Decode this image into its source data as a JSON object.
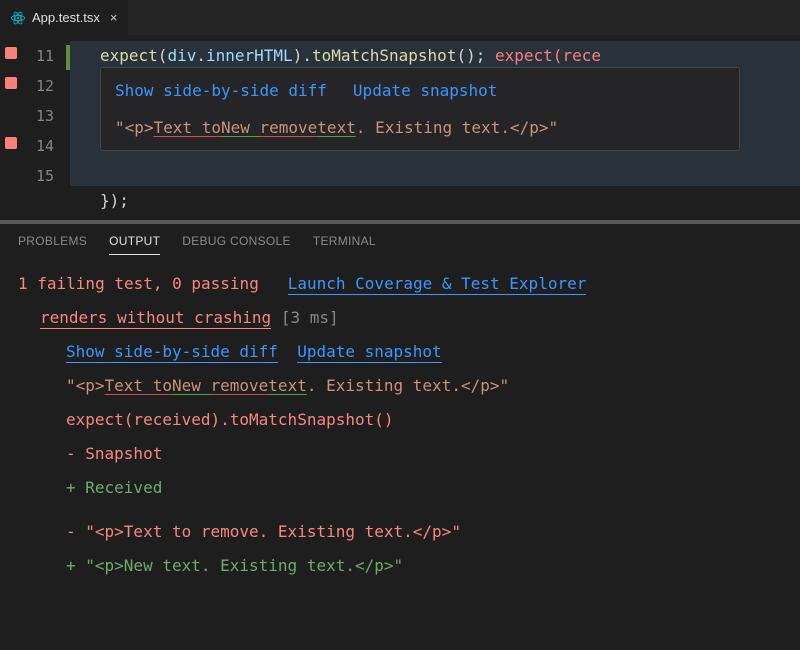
{
  "tabs": {
    "file_name": "App.test.tsx",
    "close_glyph": "×"
  },
  "gutter": {
    "line_nums": [
      "11",
      "12",
      "13",
      "14",
      "15"
    ]
  },
  "code": {
    "line11": {
      "expect": "expect",
      "lp": "(",
      "div": "div",
      "dot1": ".",
      "innerHTML": "innerHTML",
      "rp": ").",
      "toMatch": "toMatchSnapshot",
      "call": "();",
      "sp": "   ",
      "expect2": "expect",
      "lp2": "(",
      "rece": "rece"
    },
    "line15": "});"
  },
  "hover": {
    "link_diff": "Show side-by-side diff",
    "link_update": "Update snapshot",
    "snap_open": "\"<p>",
    "snap_del1": "Text to",
    "snap_add1": "New ",
    "snap_del2": "remove",
    "snap_add2": "text",
    "snap_rest": ". Existing text.</p>\""
  },
  "panel": {
    "tabs": {
      "problems": "PROBLEMS",
      "output": "OUTPUT",
      "debug": "DEBUG CONSOLE",
      "terminal": "TERMINAL"
    },
    "summary_fail": "1 failing test, 0 passing",
    "summary_link": "Launch Coverage & Test Explorer",
    "test_name": "renders without crashing",
    "test_time": "[3 ms]",
    "link_diff": "Show side-by-side diff",
    "link_update": "Update snapshot",
    "snap_open": "\"<p>",
    "snap_del1": "Text to",
    "snap_add1": "New ",
    "snap_del2": "remove",
    "snap_add2": "text",
    "snap_rest": ". Existing text.</p>\"",
    "assert": "expect(received).toMatchSnapshot()",
    "legend_snap": "- Snapshot",
    "legend_recv": "+ Received",
    "diff_minus": "- \"<p>Text to remove. Existing text.</p>\"",
    "diff_plus": "+ \"<p>New text. Existing text.</p>\""
  }
}
